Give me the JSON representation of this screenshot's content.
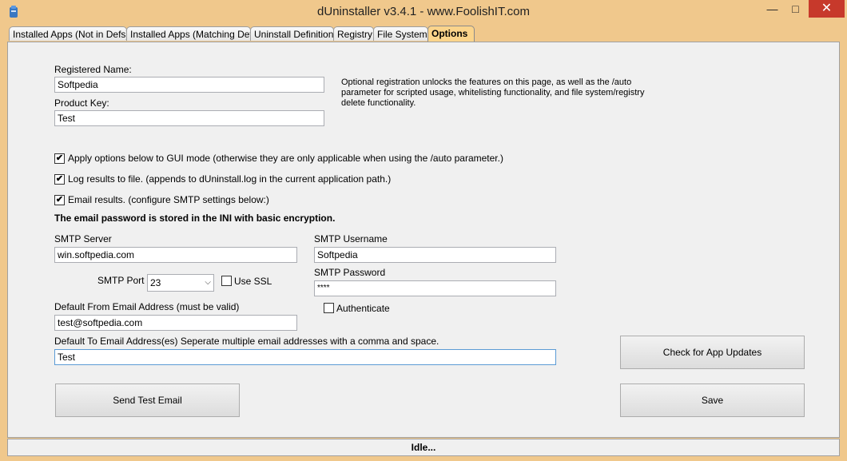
{
  "window": {
    "title": "dUninstaller v3.4.1  -  www.FoolishIT.com",
    "minimize": "—",
    "maximize": "□",
    "close": "✕",
    "icon": "app-icon"
  },
  "tabs": [
    {
      "label": "Installed Apps (Not in Defs)"
    },
    {
      "label": "Installed Apps (Matching Defs)"
    },
    {
      "label": "Uninstall Definitions"
    },
    {
      "label": "Registry"
    },
    {
      "label": "File System"
    },
    {
      "label": "Options"
    }
  ],
  "registration": {
    "name_label": "Registered Name:",
    "name_value": "Softpedia",
    "key_label": "Product Key:",
    "key_value": "Test",
    "description": "Optional registration unlocks the features on this page, as well as the /auto parameter for scripted usage, whitelisting functionality, and file system/registry delete functionality."
  },
  "options": {
    "apply_gui": {
      "label": "Apply options below to GUI mode (otherwise they are only applicable when using the /auto parameter.)",
      "checked": true
    },
    "log_results": {
      "label": "Log results to file.  (appends to dUninstall.log in the current application path.)",
      "checked": true
    },
    "email_results": {
      "label": "Email results.  (configure SMTP settings below:)",
      "checked": true
    },
    "password_note": "The email password is stored in the INI with basic encryption."
  },
  "smtp": {
    "server_label": "SMTP Server",
    "server_value": "win.softpedia.com",
    "port_label": "SMTP Port",
    "port_value": "23",
    "use_ssl_label": "Use SSL",
    "use_ssl_checked": false,
    "username_label": "SMTP Username",
    "username_value": "Softpedia",
    "password_label": "SMTP Password",
    "password_value": "****",
    "authenticate_label": "Authenticate",
    "authenticate_checked": false,
    "from_label": "Default From Email Address (must be valid)",
    "from_value": "test@softpedia.com",
    "to_label": "Default To Email Address(es)  Seperate multiple email addresses with a comma and space.",
    "to_value": "Test"
  },
  "buttons": {
    "check_updates": "Check for App Updates",
    "send_test": "Send Test Email",
    "save": "Save"
  },
  "status": "Idle...",
  "checkmark": "✔",
  "dropdown_arrow": "⌵"
}
